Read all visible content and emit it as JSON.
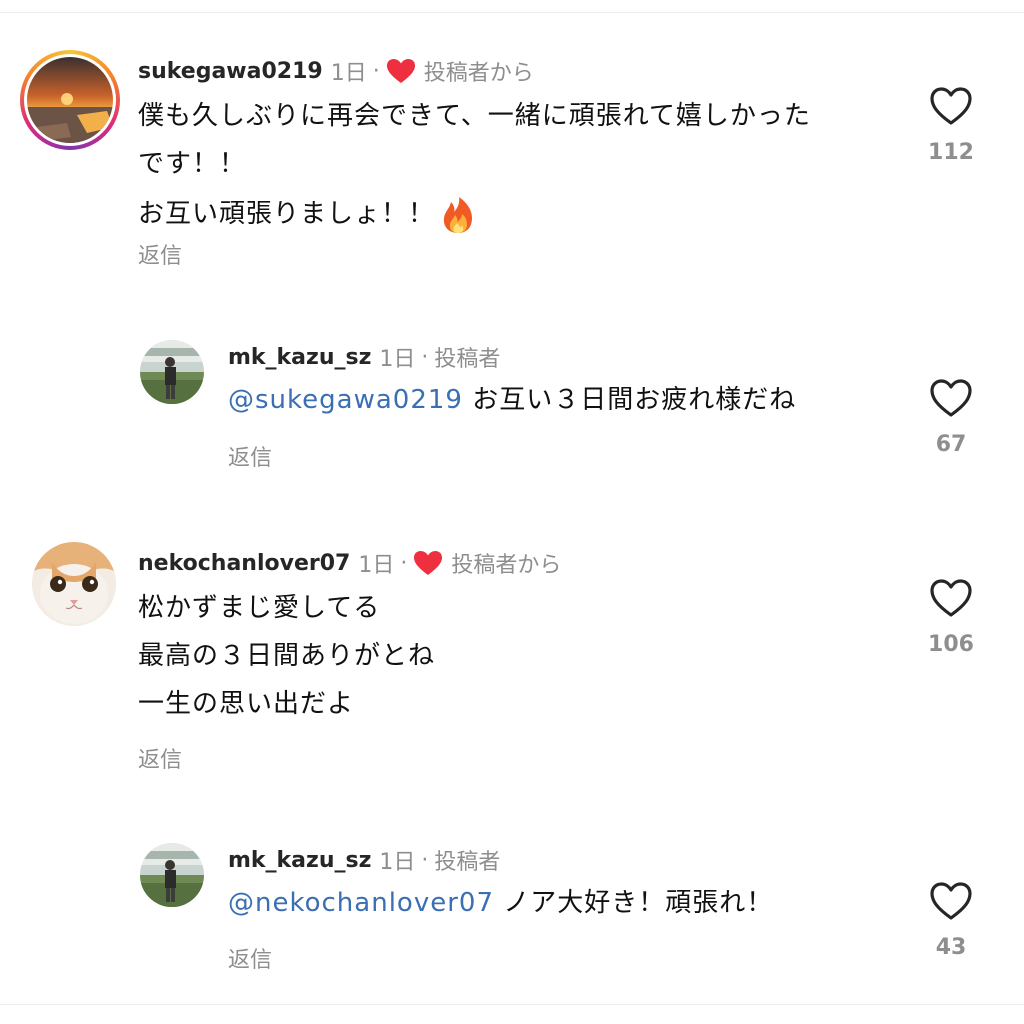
{
  "comments": [
    {
      "username": "sukegawa0219",
      "time": "1日",
      "separator": "·",
      "author_tag": "投稿者から",
      "lines": [
        "僕も久しぶりに再会できて、一緒に頑張れて嬉しかった",
        "です！！",
        "お互い頑張りましょ！！"
      ],
      "reply_label": "返信",
      "like_count": "112",
      "emoji": "fire"
    },
    {
      "username": "mk_kazu_sz",
      "time": "1日",
      "separator": "·",
      "author_tag": "投稿者",
      "mention": "@sukegawa0219",
      "lines": [
        " お互い３日間お疲れ様だね"
      ],
      "reply_label": "返信",
      "like_count": "67"
    },
    {
      "username": "nekochanlover07",
      "time": "1日",
      "separator": "·",
      "author_tag": "投稿者から",
      "lines": [
        "松かずまじ愛してる",
        "最高の３日間ありがとね",
        "一生の思い出だよ"
      ],
      "reply_label": "返信",
      "like_count": "106"
    },
    {
      "username": "mk_kazu_sz",
      "time": "1日",
      "separator": "·",
      "author_tag": "投稿者",
      "mention": "@nekochanlover07",
      "lines": [
        " ノア大好き！頑張れ！"
      ],
      "reply_label": "返信",
      "like_count": "43"
    }
  ],
  "colors": {
    "heart_badge": "#ed2f3f",
    "mention": "#3b6fb3",
    "muted": "#8e8e8e"
  }
}
